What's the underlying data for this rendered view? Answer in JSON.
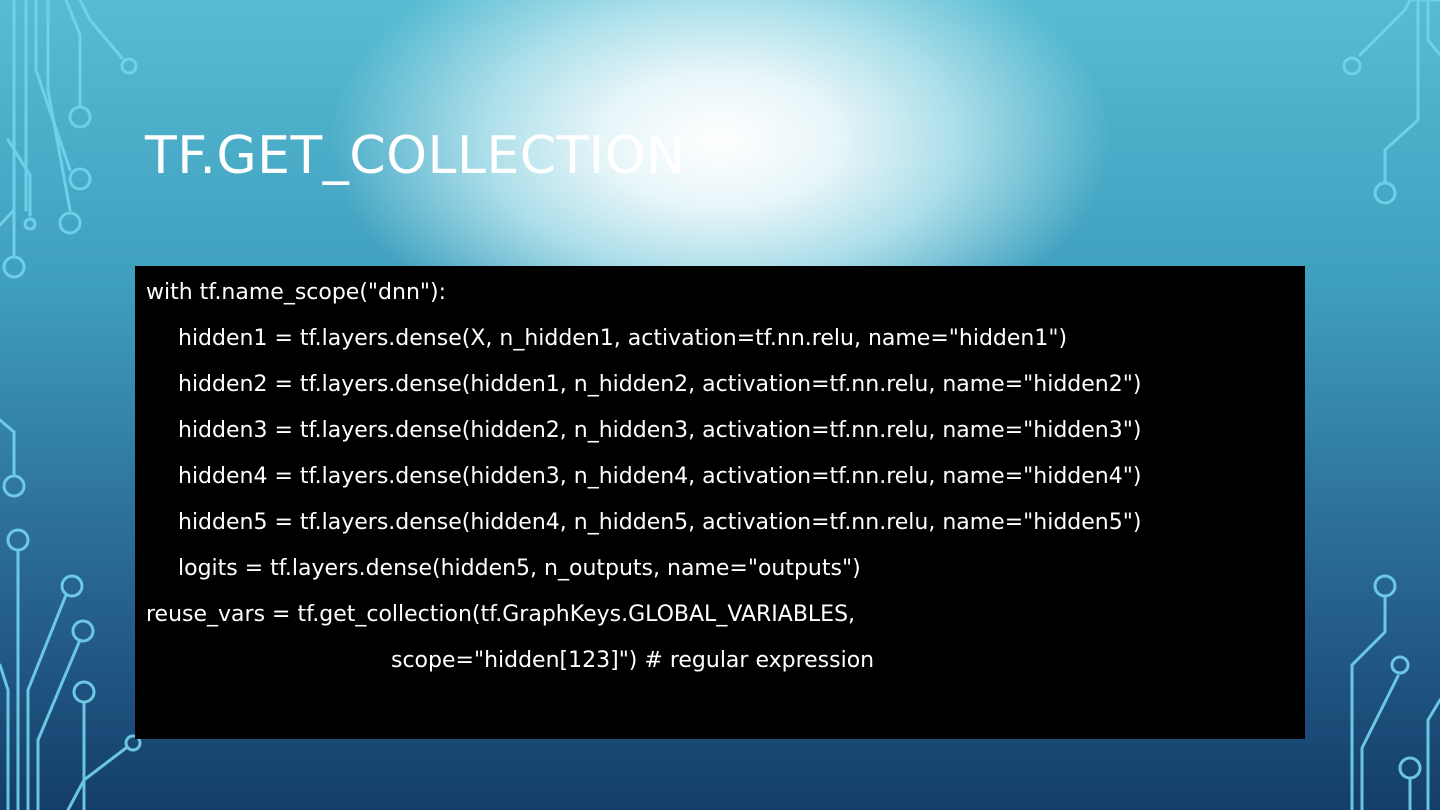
{
  "slide": {
    "title": "TF.GET_COLLECTION",
    "code_lines": [
      "with tf.name_scope(\"dnn\"):",
      "hidden1 = tf.layers.dense(X, n_hidden1, activation=tf.nn.relu, name=\"hidden1\")",
      "hidden2 = tf.layers.dense(hidden1, n_hidden2, activation=tf.nn.relu, name=\"hidden2\")",
      "hidden3 = tf.layers.dense(hidden2, n_hidden3, activation=tf.nn.relu, name=\"hidden3\")",
      "hidden4 = tf.layers.dense(hidden3, n_hidden4, activation=tf.nn.relu, name=\"hidden4\")",
      "hidden5 = tf.layers.dense(hidden4, n_hidden5, activation=tf.nn.relu, name=\"hidden5\")",
      "logits = tf.layers.dense(hidden5, n_outputs, name=\"outputs\")",
      "reuse_vars = tf.get_collection(tf.GraphKeys.GLOBAL_VARIABLES,",
      "scope=\"hidden[123]\") # regular expression"
    ]
  },
  "colors": {
    "code_background": "#000000",
    "text": "#ffffff",
    "circuit_accent": "#6fd3f0"
  },
  "decoration": {
    "icon": "circuit-board-lines"
  }
}
